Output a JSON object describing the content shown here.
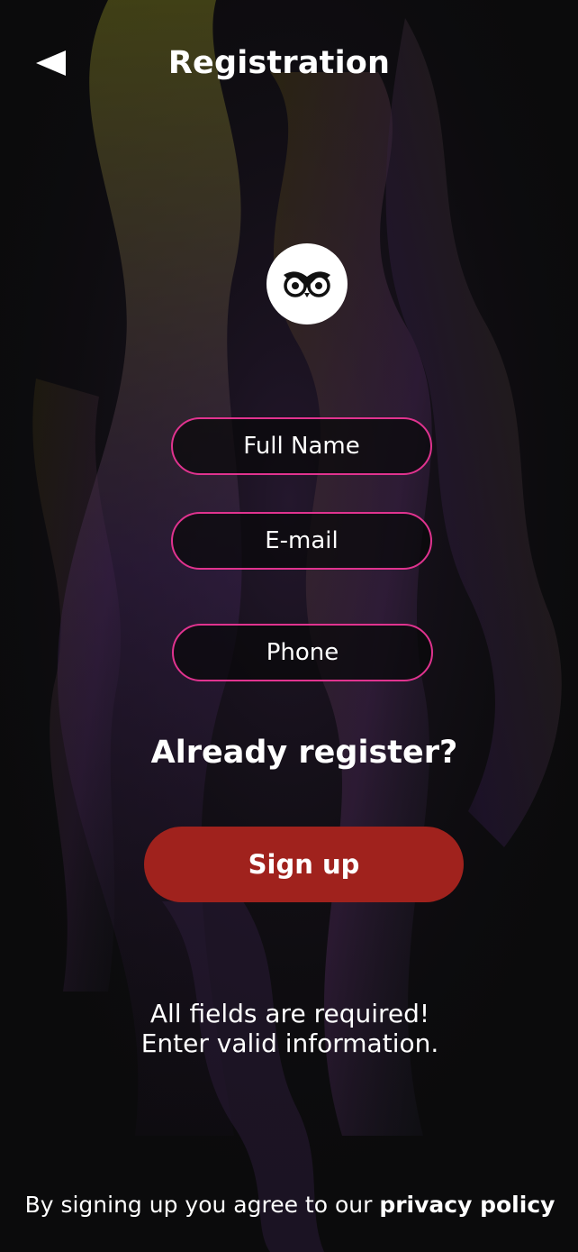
{
  "header": {
    "title": "Registration",
    "back_icon": "back-arrow-icon"
  },
  "logo": {
    "icon": "owl-logo-icon"
  },
  "form": {
    "full_name_placeholder": "Full Name",
    "email_placeholder": "E-mail",
    "phone_placeholder": "Phone"
  },
  "already_registered_link": "Already register?",
  "signup_button_label": "Sign up",
  "notice": {
    "line1": "All fields are required!",
    "line2": "Enter valid information."
  },
  "footer": {
    "text": "By signing up you agree to our ",
    "link": "privacy policy"
  },
  "colors": {
    "background": "#0b0b0c",
    "field_border": "#e0338f",
    "signup_button": "#a0221d",
    "text": "#ffffff"
  }
}
